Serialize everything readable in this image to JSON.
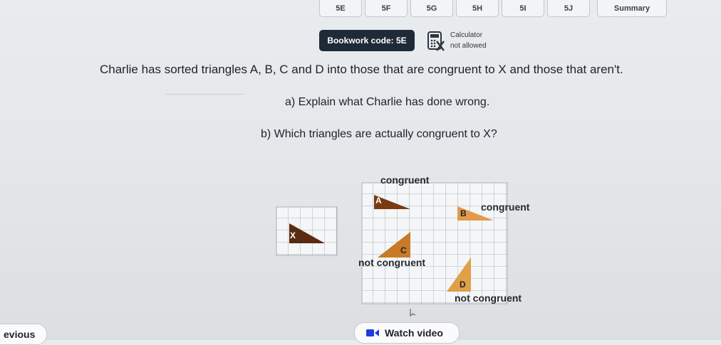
{
  "tabs": [
    {
      "label": "5E",
      "width": 60
    },
    {
      "label": "5F",
      "width": 60
    },
    {
      "label": "5G",
      "width": 60
    },
    {
      "label": "5H",
      "width": 60
    },
    {
      "label": "5I",
      "width": 60
    },
    {
      "label": "5J",
      "width": 60
    }
  ],
  "summary_tab": "Summary",
  "bookwork_code": "Bookwork code: 5E",
  "calculator": {
    "title": "Calculator",
    "status": "not allowed",
    "icon": "calculator-crossed-icon"
  },
  "question": {
    "main": "Charlie has sorted triangles A, B, C and D into those that are congruent to X and those that aren't.",
    "part_a": "a) Explain what Charlie has done wrong.",
    "part_b": "b) Which triangles are actually congruent to X?"
  },
  "figure": {
    "label_congruent_a": "congruent",
    "label_congruent_b": "congruent",
    "label_not_congruent_c": "not congruent",
    "label_not_congruent_d": "not congruent",
    "triangles": {
      "X": "X",
      "A": "A",
      "B": "B",
      "C": "C",
      "D": "D"
    },
    "colors": {
      "X": "#5a2a12",
      "A": "#7a3b12",
      "B": "#e39a4a",
      "C": "#c97a26",
      "D": "#dfa047"
    }
  },
  "nav": {
    "previous": "evious",
    "watch_video": "Watch video"
  }
}
